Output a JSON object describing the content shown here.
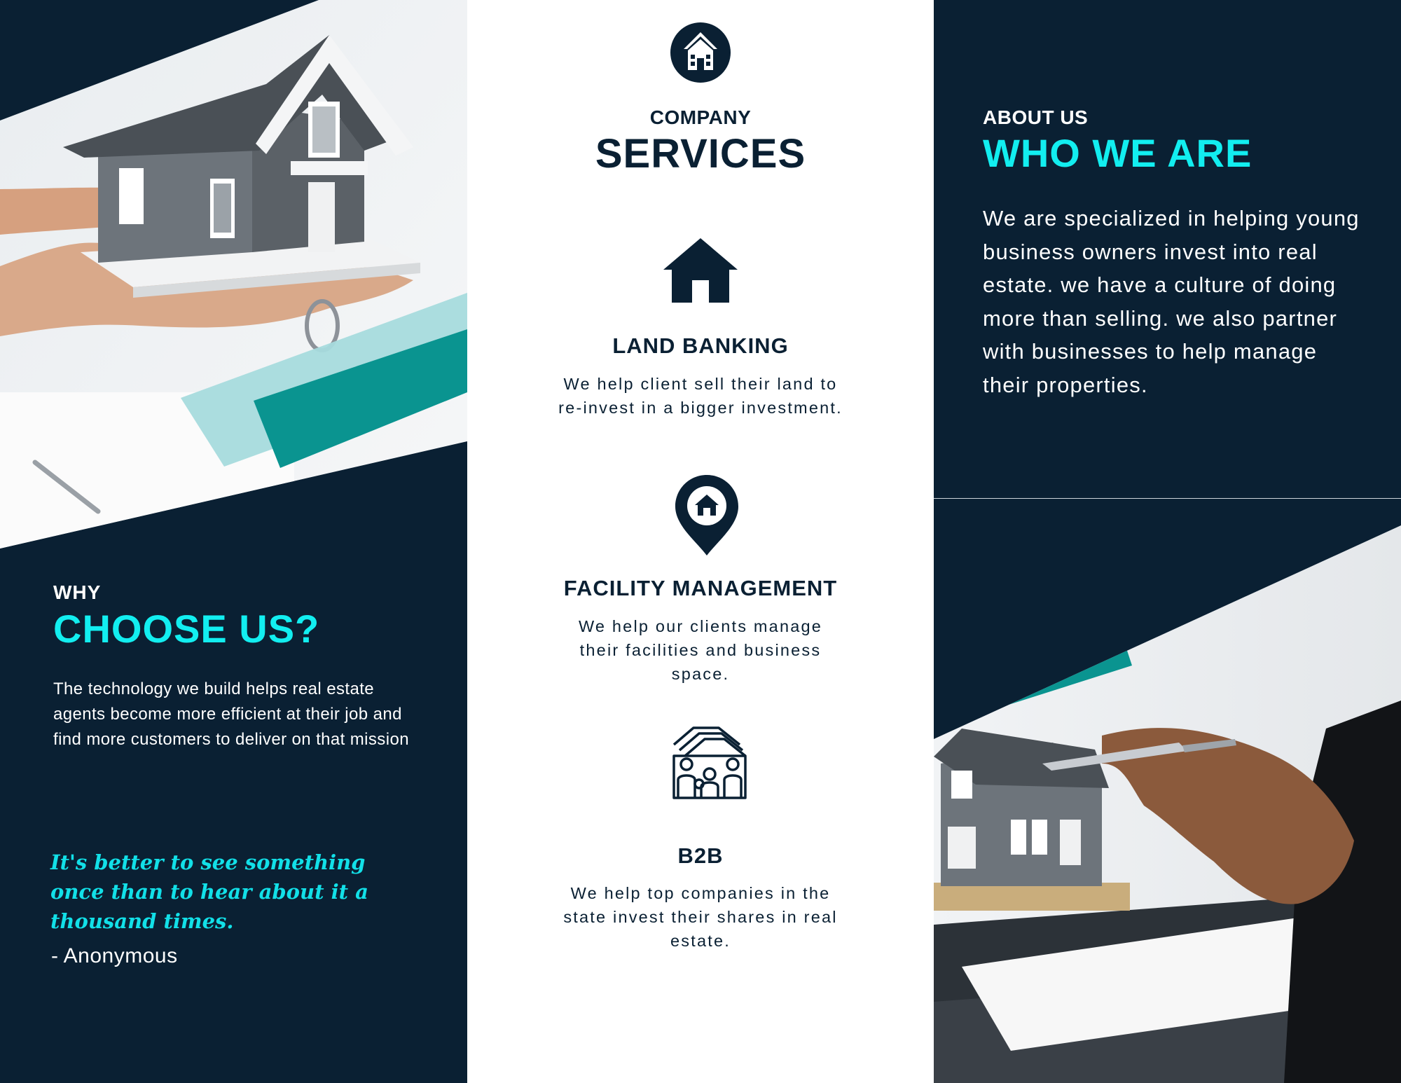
{
  "colors": {
    "navy": "#0a2033",
    "cyan": "#12eef0",
    "teal": "#0a9490",
    "white": "#ffffff"
  },
  "left_panel": {
    "photo": "house-model-in-hands-photo",
    "why_small": "WHY",
    "why_big": "CHOOSE US?",
    "body": "The technology we build helps real estate agents become more efficient at their job and find more customers to deliver on that mission",
    "quote": "It's better to see something once than to hear about it a thousand times.",
    "author": "- Anonymous"
  },
  "middle_panel": {
    "top_icon": "house-circle-icon",
    "heading_small": "COMPANY",
    "heading_big": "SERVICES",
    "services": [
      {
        "icon": "house-icon",
        "title": "LAND BANKING",
        "description": "We help client sell their land to re-invest in a bigger investment."
      },
      {
        "icon": "location-pin-house-icon",
        "title": "FACILITY MANAGEMENT",
        "description": "We help our clients manage their facilities and business space."
      },
      {
        "icon": "family-houses-icon",
        "title": "B2B",
        "description": "We help top companies in the state invest their shares in real estate."
      }
    ]
  },
  "right_panel": {
    "about_small": "ABOUT US",
    "about_big": "WHO WE ARE",
    "body": "We are specialized in helping young business owners invest into real estate. we have a culture of doing more than selling. we also partner with businesses to help manage their properties.",
    "photo": "hand-with-pen-and-house-model-photo"
  }
}
